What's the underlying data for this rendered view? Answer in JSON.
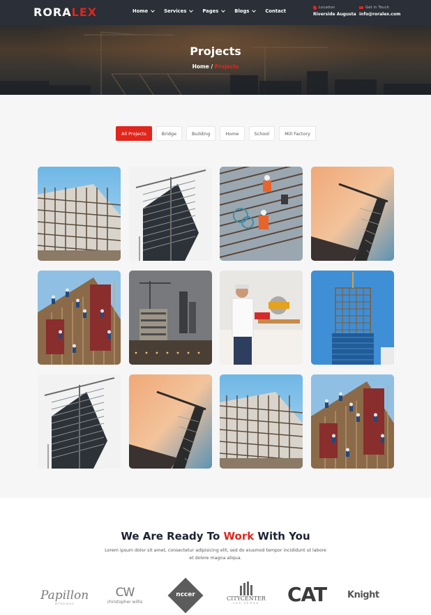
{
  "header": {
    "logo_main": "RORA",
    "logo_accent": "LEX",
    "nav": [
      {
        "label": "Home",
        "dropdown": true
      },
      {
        "label": "Services",
        "dropdown": true
      },
      {
        "label": "Pages",
        "dropdown": true
      },
      {
        "label": "Blogs",
        "dropdown": true
      },
      {
        "label": "Contact",
        "dropdown": false
      }
    ],
    "location_label": "Location",
    "location_value": "Riverside Augusta",
    "touch_label": "Get in Touch",
    "touch_value": "info@roralex.com",
    "accent_color": "#e1261c"
  },
  "banner": {
    "title": "Projects",
    "crumb_home": "Home",
    "crumb_sep": "/",
    "crumb_current": "Projects"
  },
  "filters": [
    "All Projects",
    "Bridge",
    "Building",
    "Home",
    "School",
    "Mill Factory"
  ],
  "active_filter": "All Projects",
  "gallery": [
    {
      "scene": "building-frame"
    },
    {
      "scene": "tower-crane"
    },
    {
      "scene": "rebar-workers"
    },
    {
      "scene": "crane-sunset"
    },
    {
      "scene": "roof-workers"
    },
    {
      "scene": "city-site"
    },
    {
      "scene": "saw-worker"
    },
    {
      "scene": "glass-tower"
    },
    {
      "scene": "tower-crane"
    },
    {
      "scene": "crane-sunset"
    },
    {
      "scene": "building-frame"
    },
    {
      "scene": "roof-workers"
    }
  ],
  "ready": {
    "title_pre": "We Are Ready To ",
    "title_hl": "Work",
    "title_post": " With You",
    "text": "Lorem ipsum dolor sit amet, consectetur adipisicing elit, sed do eiusmod tempor incididunt ut labore et dolore magna aliqua."
  },
  "brands": {
    "papillon": "Papillon",
    "papillon_sub": "WEDDINGS",
    "cw": "CW",
    "cw_name": "christopher willis",
    "nccer": "nccer",
    "citycenter": "CITYCENTER",
    "citycenter_sub": "LAS VEGAS",
    "cat": "CAT",
    "knight": "Knight"
  }
}
